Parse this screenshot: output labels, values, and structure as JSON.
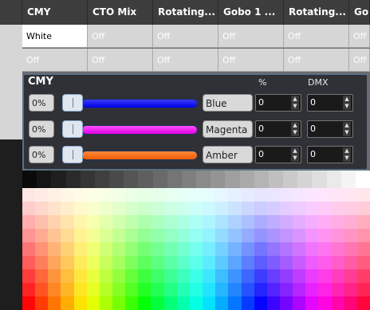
{
  "table": {
    "headers": [
      "CMY",
      "CTO Mix",
      "Rotating...",
      "Gobo 1 ...",
      "Rotating...",
      "Go"
    ],
    "rows": [
      [
        "White",
        "Off",
        "Off",
        "Off",
        "Off",
        "Off"
      ],
      [
        "Off",
        "Off",
        "Off",
        "Off",
        "Off",
        "Off"
      ]
    ]
  },
  "panel": {
    "title": "CMY",
    "pct_label": "%",
    "dmx_label": "DMX",
    "channels": [
      {
        "percent_button": "0%",
        "name": "Blue",
        "percent_value": "0",
        "dmx_value": "0",
        "color": "#0000ff"
      },
      {
        "percent_button": "0%",
        "name": "Magenta",
        "percent_value": "0",
        "dmx_value": "0",
        "color": "#ff00ff"
      },
      {
        "percent_button": "0%",
        "name": "Amber",
        "percent_value": "0",
        "dmx_value": "0",
        "color": "#ff6600"
      }
    ]
  },
  "palette": {
    "label": "color-palette"
  }
}
